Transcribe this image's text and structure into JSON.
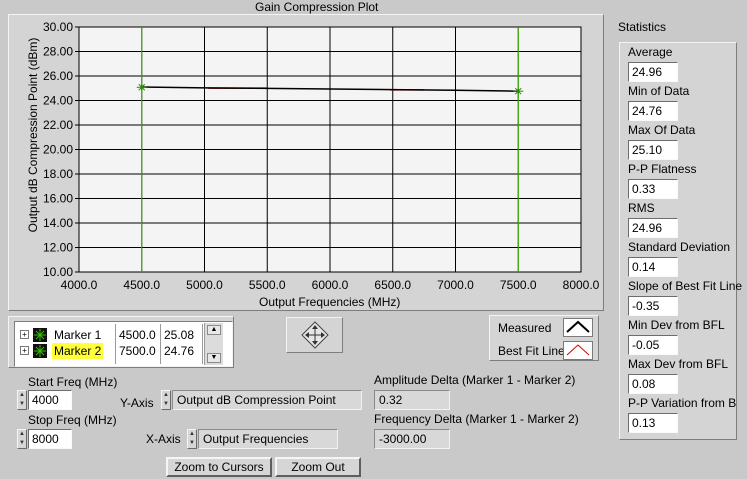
{
  "graph": {
    "title": "Gain Compression Plot",
    "xlabel": "Output Frequencies (MHz)",
    "ylabel": "Output dB Compression Point (dBm)"
  },
  "chart_data": {
    "type": "line",
    "title": "Gain Compression Plot",
    "xlabel": "Output Frequencies (MHz)",
    "ylabel": "Output dB Compression Point (dBm)",
    "xlim": [
      4000,
      8000
    ],
    "ylim": [
      10,
      30
    ],
    "xticks": [
      "4000.0",
      "4500.0",
      "5000.0",
      "5500.0",
      "6000.0",
      "6500.0",
      "7000.0",
      "7500.0",
      "8000.0"
    ],
    "yticks": [
      "10.00",
      "12.00",
      "14.00",
      "16.00",
      "18.00",
      "20.00",
      "22.00",
      "24.00",
      "26.00",
      "28.00",
      "30.00"
    ],
    "grid": true,
    "series": [
      {
        "name": "Measured",
        "color": "#000000",
        "x": [
          4500,
          5000,
          5500,
          6000,
          6500,
          7000,
          7500
        ],
        "y": [
          25.1,
          25.03,
          24.99,
          24.94,
          24.89,
          24.84,
          24.76
        ]
      },
      {
        "name": "Best Fit Line",
        "color": "#d40000",
        "segments": [
          {
            "x": [
              5030,
              5500
            ],
            "y": [
              25.01,
              25.01
            ]
          },
          {
            "x": [
              6480,
              6750
            ],
            "y": [
              24.87,
              24.87
            ]
          }
        ]
      }
    ],
    "cursors": [
      {
        "name": "Marker 1",
        "x": 4500,
        "y": 25.08,
        "color": "#38c000"
      },
      {
        "name": "Marker 2",
        "x": 7500,
        "y": 24.76,
        "color": "#38c000"
      }
    ]
  },
  "markers": [
    {
      "name": "Marker 1",
      "x": "4500.0",
      "y": "25.08",
      "highlight": false
    },
    {
      "name": "Marker 2",
      "x": "7500.0",
      "y": "24.76",
      "highlight": true
    }
  ],
  "legend": {
    "items": [
      {
        "label": "Measured"
      },
      {
        "label": "Best Fit Line"
      }
    ]
  },
  "controls": {
    "start_freq_label": "Start Freq (MHz)",
    "start_freq_value": "4000",
    "stop_freq_label": "Stop Freq (MHz)",
    "stop_freq_value": "8000",
    "y_axis_label": "Y-Axis",
    "y_axis_value": "Output dB Compression Point",
    "x_axis_label": "X-Axis",
    "x_axis_value": "Output Frequencies",
    "amp_delta_label": "Amplitude Delta (Marker 1 - Marker 2)",
    "amp_delta_value": "0.32",
    "freq_delta_label": "Frequency Delta (Marker 1 - Marker 2)",
    "freq_delta_value": "-3000.00",
    "zoom_cursors": "Zoom to Cursors",
    "zoom_out": "Zoom Out"
  },
  "statistics": {
    "title": "Statistics",
    "items": [
      {
        "label": "Average",
        "value": "24.96"
      },
      {
        "label": "Min of Data",
        "value": "24.76"
      },
      {
        "label": "Max Of Data",
        "value": "25.10"
      },
      {
        "label": "P-P Flatness",
        "value": "0.33"
      },
      {
        "label": "RMS",
        "value": "24.96"
      },
      {
        "label": "Standard Deviation",
        "value": "0.14"
      },
      {
        "label": "Slope of Best Fit Line",
        "value": "-0.35"
      },
      {
        "label": "Min Dev from BFL",
        "value": "-0.05"
      },
      {
        "label": "Max Dev from BFL",
        "value": "0.08"
      },
      {
        "label": "P-P Variation from B",
        "value": "0.13"
      }
    ]
  }
}
